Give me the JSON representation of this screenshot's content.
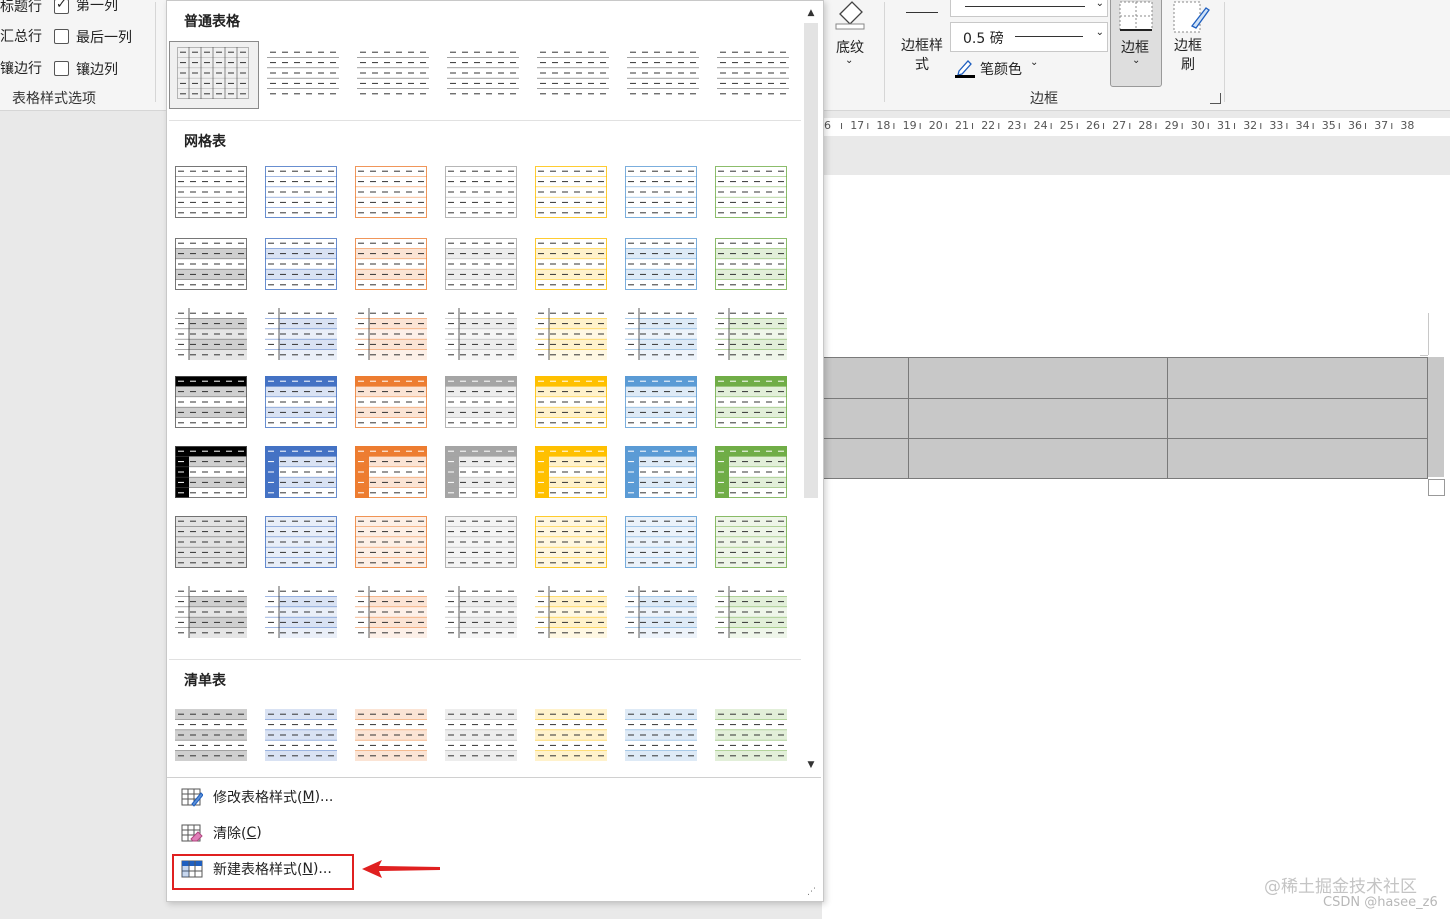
{
  "ribbon": {
    "options": [
      {
        "label": "标题行",
        "checked": true
      },
      {
        "label": "汇总行",
        "checked": false
      },
      {
        "label": "镶边行",
        "checked": false
      }
    ],
    "options_right": [
      {
        "label": "第一列",
        "checked": true
      },
      {
        "label": "最后一列",
        "checked": false
      },
      {
        "label": "镶边列",
        "checked": false
      }
    ],
    "options_group_label": "表格样式选项",
    "shading_label": "底纹",
    "border_styles_label": "边框样式",
    "pen_weight": "0.5 磅",
    "pen_color_label": "笔颜色",
    "borders_label": "边框",
    "border_painter_label": "边框刷",
    "borders_group_label": "边框"
  },
  "ruler": [
    "6",
    "17",
    "18",
    "19",
    "20",
    "21",
    "22",
    "23",
    "24",
    "25",
    "26",
    "27",
    "28",
    "29",
    "30",
    "31",
    "32",
    "33",
    "34",
    "35",
    "36",
    "37",
    "38"
  ],
  "panel": {
    "sections": [
      {
        "title": "普通表格"
      },
      {
        "title": "网格表"
      },
      {
        "title": "清单表"
      }
    ],
    "palette": [
      "#000000",
      "#4472c4",
      "#ed7d31",
      "#a5a5a5",
      "#ffc000",
      "#5b9bd5",
      "#70ad47"
    ],
    "light_palette": [
      "#cfcfcf",
      "#d9e2f3",
      "#fbe4d5",
      "#ededed",
      "#fff2cc",
      "#deeaf6",
      "#e2efd9"
    ],
    "menu": [
      {
        "label": "修改表格样式(",
        "key": "M",
        "suffix": ")...",
        "icon": "modify-table-style-icon"
      },
      {
        "label": "清除(",
        "key": "C",
        "suffix": ")",
        "icon": "clear-table-style-icon"
      },
      {
        "label": "新建表格样式(",
        "key": "N",
        "suffix": ")...",
        "icon": "new-table-style-icon"
      }
    ]
  },
  "watermark": {
    "line1": "@稀土掘金技术社区",
    "line2": "CSDN @hasee_z6"
  },
  "accent": {
    "highlight": "#e02020"
  }
}
